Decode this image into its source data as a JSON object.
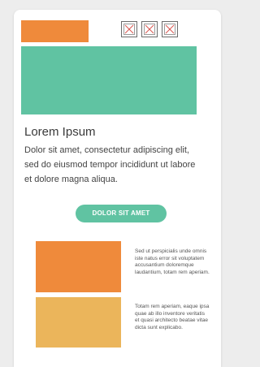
{
  "colors": {
    "background": "#ededed",
    "card": "#ffffff",
    "orange": "#ef8a3b",
    "teal": "#60c3a2",
    "light_orange": "#ebb55b",
    "close_x": "#d9534f"
  },
  "header": {
    "controls": [
      {
        "icon": "close-icon"
      },
      {
        "icon": "close-icon"
      },
      {
        "icon": "close-icon"
      }
    ]
  },
  "content": {
    "title": "Lorem Ipsum",
    "description": "Dolor sit amet, consectetur adipiscing elit, sed do eiusmod tempor incididunt ut labore et dolore magna aliqua.",
    "cta_label": "DOLOR SIT AMET"
  },
  "items": [
    {
      "text": "Sed ut perspicialis unde omnis iste natus error sit voluptatem accusantium doloremque laudantium, totam rem aperiam."
    },
    {
      "text": "Totam rem aperiam, eaque ipsa quae ab illo inventore veritatis et quasi architecto beatae vitae dicta sunt explicabo."
    }
  ]
}
